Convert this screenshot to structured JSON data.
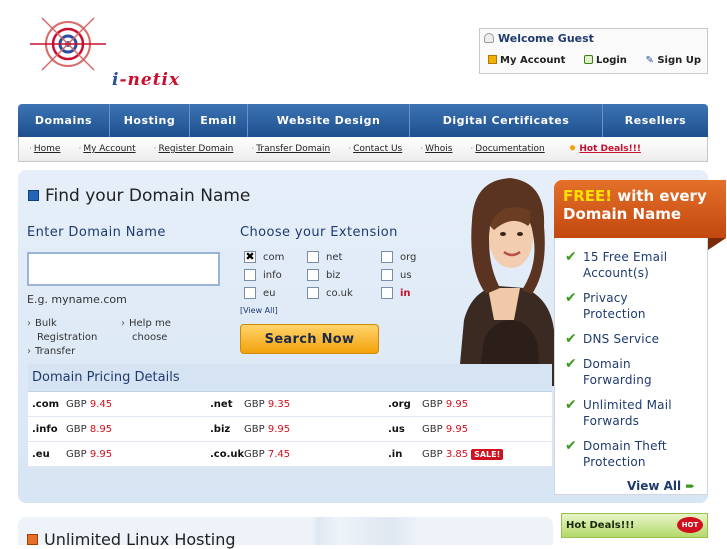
{
  "brand": {
    "logo_text_a": "i",
    "logo_text_b": "-netix"
  },
  "welcome": {
    "title": "Welcome Guest",
    "my_account": "My Account",
    "login": "Login",
    "signup": "Sign Up"
  },
  "nav": {
    "items": [
      {
        "label": "Domains"
      },
      {
        "label": "Hosting"
      },
      {
        "label": "Email"
      },
      {
        "label": "Website Design"
      },
      {
        "label": "Digital Certificates"
      },
      {
        "label": "Resellers"
      }
    ]
  },
  "subnav": {
    "links": [
      {
        "label": "Home"
      },
      {
        "label": "My Account"
      },
      {
        "label": "Register Domain"
      },
      {
        "label": "Transfer Domain"
      },
      {
        "label": "Contact Us"
      },
      {
        "label": "Whois"
      },
      {
        "label": "Documentation"
      }
    ],
    "hot_deals": "Hot Deals!!!"
  },
  "search": {
    "title": "Find your Domain Name",
    "enter_label": "Enter Domain Name",
    "input_value": "",
    "example": "E.g. myname.com",
    "bulk": "Bulk",
    "registration": "Registration",
    "help_me": "Help me",
    "choose": "choose",
    "transfer": "Transfer",
    "choose_label": "Choose your Extension",
    "view_all": "[View All]",
    "button": "Search Now",
    "extensions": [
      {
        "label": "com",
        "checked": true
      },
      {
        "label": "net",
        "checked": false
      },
      {
        "label": "org",
        "checked": false
      },
      {
        "label": "info",
        "checked": false
      },
      {
        "label": "biz",
        "checked": false
      },
      {
        "label": "us",
        "checked": false
      },
      {
        "label": "eu",
        "checked": false
      },
      {
        "label": "co.uk",
        "checked": false
      },
      {
        "label": "in",
        "checked": false
      }
    ]
  },
  "pricing": {
    "title": "Domain Pricing Details",
    "currency": "GBP",
    "sale_label": "SALE!",
    "rows": [
      [
        {
          "tld": ".com",
          "price": "9.45"
        },
        {
          "tld": ".net",
          "price": "9.35"
        },
        {
          "tld": ".org",
          "price": "9.95"
        }
      ],
      [
        {
          "tld": ".info",
          "price": "8.95"
        },
        {
          "tld": ".biz",
          "price": "9.95"
        },
        {
          "tld": ".us",
          "price": "9.95"
        }
      ],
      [
        {
          "tld": ".eu",
          "price": "9.95"
        },
        {
          "tld": ".co.uk",
          "price": "7.45"
        },
        {
          "tld": ".in",
          "price": "3.85"
        }
      ]
    ]
  },
  "free": {
    "head_a": "FREE!",
    "head_b": " with every",
    "head_c": "Domain Name",
    "items": [
      {
        "l1": "15 Free Email",
        "l2": "Account(s)"
      },
      {
        "l1": "Privacy",
        "l2": "Protection"
      },
      {
        "l1": "DNS Service",
        "l2": ""
      },
      {
        "l1": "Domain",
        "l2": "Forwarding"
      },
      {
        "l1": "Unlimited Mail",
        "l2": "Forwards"
      },
      {
        "l1": "Domain Theft",
        "l2": "Protection"
      }
    ],
    "view_all": "View All"
  },
  "bottom": {
    "hosting_title": "Unlimited Linux Hosting",
    "hot_deals": "Hot Deals!!!",
    "hot_badge": "HOT"
  },
  "colors": {
    "nav": "#2a5f9e",
    "accent_orange": "#e4702a",
    "price_red": "#d0101e",
    "check_green": "#3c9a1c"
  }
}
